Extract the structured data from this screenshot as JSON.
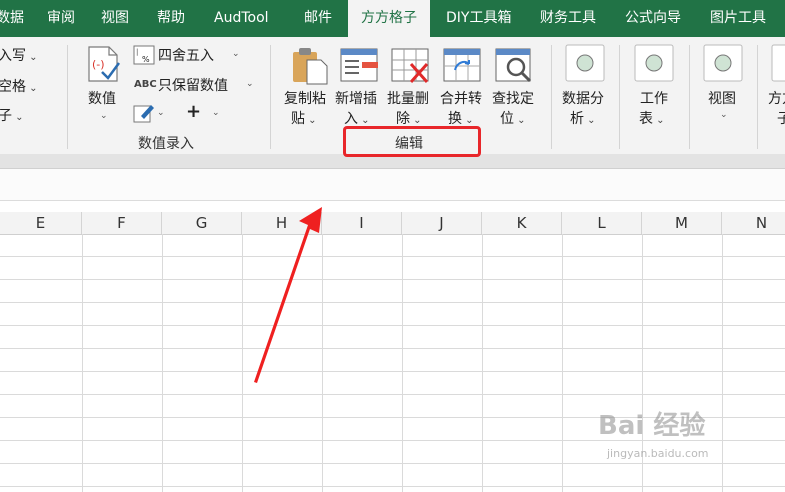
{
  "tabs": [
    {
      "label": "数据",
      "active": false
    },
    {
      "label": "审阅",
      "active": false
    },
    {
      "label": "视图",
      "active": false
    },
    {
      "label": "帮助",
      "active": false
    },
    {
      "label": "AudTool",
      "active": false
    },
    {
      "label": "邮件",
      "active": false
    },
    {
      "label": "方方格子",
      "active": true
    },
    {
      "label": "DIY工具箱",
      "active": false
    },
    {
      "label": "财务工具",
      "active": false
    },
    {
      "label": "公式向导",
      "active": false
    },
    {
      "label": "图片工具",
      "active": false
    }
  ],
  "ribbon": {
    "left_items": [
      "入写",
      "空格",
      "子"
    ],
    "numeric_group": {
      "value_button": "数值",
      "round_label": "四舍五入",
      "keep_value_label": "只保留数值",
      "abc_glyph": "ABC",
      "plus_glyph": "+",
      "label": "数值录入"
    },
    "edit_group": {
      "buttons": [
        {
          "line1": "复制粘",
          "line2": "贴"
        },
        {
          "line1": "新增插",
          "line2": "入"
        },
        {
          "line1": "批量删",
          "line2": "除"
        },
        {
          "line1": "合并转",
          "line2": "换"
        },
        {
          "line1": "查找定",
          "line2": "位"
        }
      ],
      "label": "编辑"
    },
    "data_analysis": {
      "line1": "数据分",
      "line2": "析"
    },
    "worksheet": {
      "line1": "工作",
      "line2": "表"
    },
    "view": {
      "line1": "视图"
    },
    "fangfang": {
      "line1": "方方",
      "line2": "子"
    }
  },
  "columns": [
    "E",
    "F",
    "G",
    "H",
    "I",
    "J",
    "K",
    "L",
    "M",
    "N"
  ],
  "watermark": {
    "text": "Bai 经验",
    "url": "jingyan.baidu.com"
  },
  "colors": {
    "brand": "#217346",
    "highlight": "#e8262a"
  }
}
